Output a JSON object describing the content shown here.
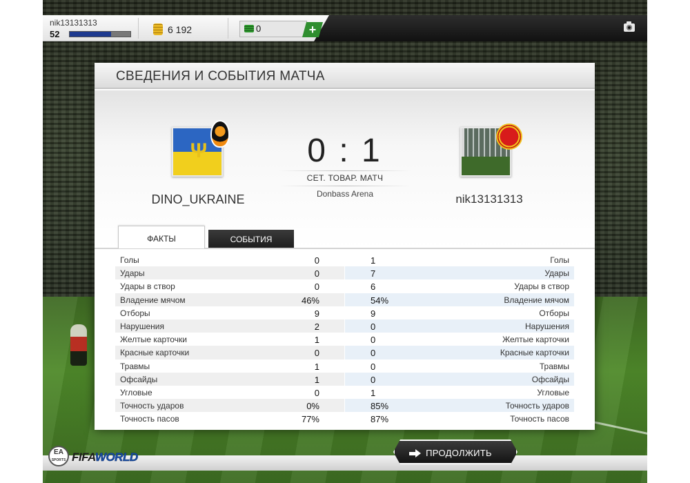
{
  "topbar": {
    "username": "nik13131313",
    "level": "52",
    "xp_progress": 0.68,
    "coins": "6 192",
    "points": "0",
    "add_label": "+"
  },
  "panel": {
    "title": "СВЕДЕНИЯ И СОБЫТИЯ МАТЧА"
  },
  "match": {
    "home_team": "DINO_UKRAINE",
    "away_team": "nik13131313",
    "score": "0 : 1",
    "match_type": "СЕТ. ТОВАР. МАТЧ",
    "stadium": "Donbass Arena"
  },
  "tabs": {
    "facts": "ФАКТЫ",
    "events": "СОБЫТИЯ"
  },
  "stats": [
    {
      "label": "Голы",
      "home": "0",
      "away": "1"
    },
    {
      "label": "Удары",
      "home": "0",
      "away": "7"
    },
    {
      "label": "Удары в створ",
      "home": "0",
      "away": "6"
    },
    {
      "label": "Владение мячом",
      "home": "46%",
      "away": "54%"
    },
    {
      "label": "Отборы",
      "home": "9",
      "away": "9"
    },
    {
      "label": "Нарушения",
      "home": "2",
      "away": "0"
    },
    {
      "label": "Желтые карточки",
      "home": "1",
      "away": "0"
    },
    {
      "label": "Красные карточки",
      "home": "0",
      "away": "0"
    },
    {
      "label": "Травмы",
      "home": "1",
      "away": "0"
    },
    {
      "label": "Офсайды",
      "home": "1",
      "away": "0"
    },
    {
      "label": "Угловые",
      "home": "0",
      "away": "1"
    },
    {
      "label": "Точность ударов",
      "home": "0%",
      "away": "85%"
    },
    {
      "label": "Точность пасов",
      "home": "77%",
      "away": "87%"
    }
  ],
  "footer": {
    "continue_label": "ПРОДОЛЖИТЬ",
    "logo_fifa": "FIFA",
    "logo_world": "WORLD",
    "ea_label": "EA",
    "ea_sports": "SPORTS"
  },
  "colors": {
    "accent_green": "#2f8e2f",
    "xp_blue": "#1e3a8f",
    "row_alt_left": "#efefef",
    "row_alt_right": "#e8f0f8"
  }
}
